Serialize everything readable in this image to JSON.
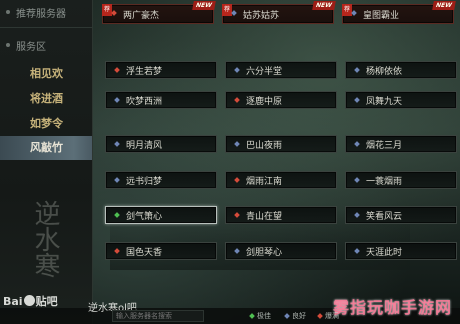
{
  "sidebar": {
    "recommended_header": "推荐服务器",
    "server_zone_header": "服务区",
    "items": [
      "相见欢",
      "将进酒",
      "如梦令",
      "风敲竹"
    ],
    "active_index": 3,
    "art_text": "逆水寒"
  },
  "top_row": [
    {
      "name": "两广豪杰",
      "rec": "荐",
      "badge": "NEW",
      "status": "red"
    },
    {
      "name": "姑苏姑苏",
      "rec": "荐",
      "badge": "NEW",
      "status": "blue"
    },
    {
      "name": "皇图霸业",
      "rec": "荐",
      "badge": "NEW",
      "status": "blue"
    }
  ],
  "servers": [
    {
      "name": "浮生若梦",
      "status": "red"
    },
    {
      "name": "六分半堂",
      "status": "blue"
    },
    {
      "name": "杨柳依依",
      "status": "blue"
    },
    {
      "name": "吹梦西洲",
      "status": "blue"
    },
    {
      "name": "逐鹿中原",
      "status": "red"
    },
    {
      "name": "凤舞九天",
      "status": "blue"
    },
    {
      "name": "明月清风",
      "status": "blue"
    },
    {
      "name": "巴山夜雨",
      "status": "blue"
    },
    {
      "name": "烟花三月",
      "status": "blue"
    },
    {
      "name": "远书归梦",
      "status": "blue"
    },
    {
      "name": "烟雨江南",
      "status": "red"
    },
    {
      "name": "一蓑烟雨",
      "status": "blue"
    },
    {
      "name": "剑气箫心",
      "status": "green"
    },
    {
      "name": "青山在望",
      "status": "red"
    },
    {
      "name": "笑看风云",
      "status": "blue"
    },
    {
      "name": "国色天香",
      "status": "red"
    },
    {
      "name": "剑胆琴心",
      "status": "blue"
    },
    {
      "name": "天涯此时",
      "status": "blue"
    }
  ],
  "highlighted_index": 12,
  "bottom": {
    "baidu_text": "Bai",
    "baidu_suffix": "贴吧",
    "forum_name": "逆水寒ol吧",
    "search_placeholder": "输入服务器名搜索",
    "legend": [
      {
        "label": "极佳",
        "color": "#4fbf52"
      },
      {
        "label": "良好",
        "color": "#6f86b5"
      },
      {
        "label": "爆满",
        "color": "#d44b3a"
      }
    ]
  },
  "watermark": "雾指玩咖手游网",
  "colors": {
    "red": "#d44b3a",
    "green": "#4fbf52",
    "blue": "#6f86b5"
  }
}
